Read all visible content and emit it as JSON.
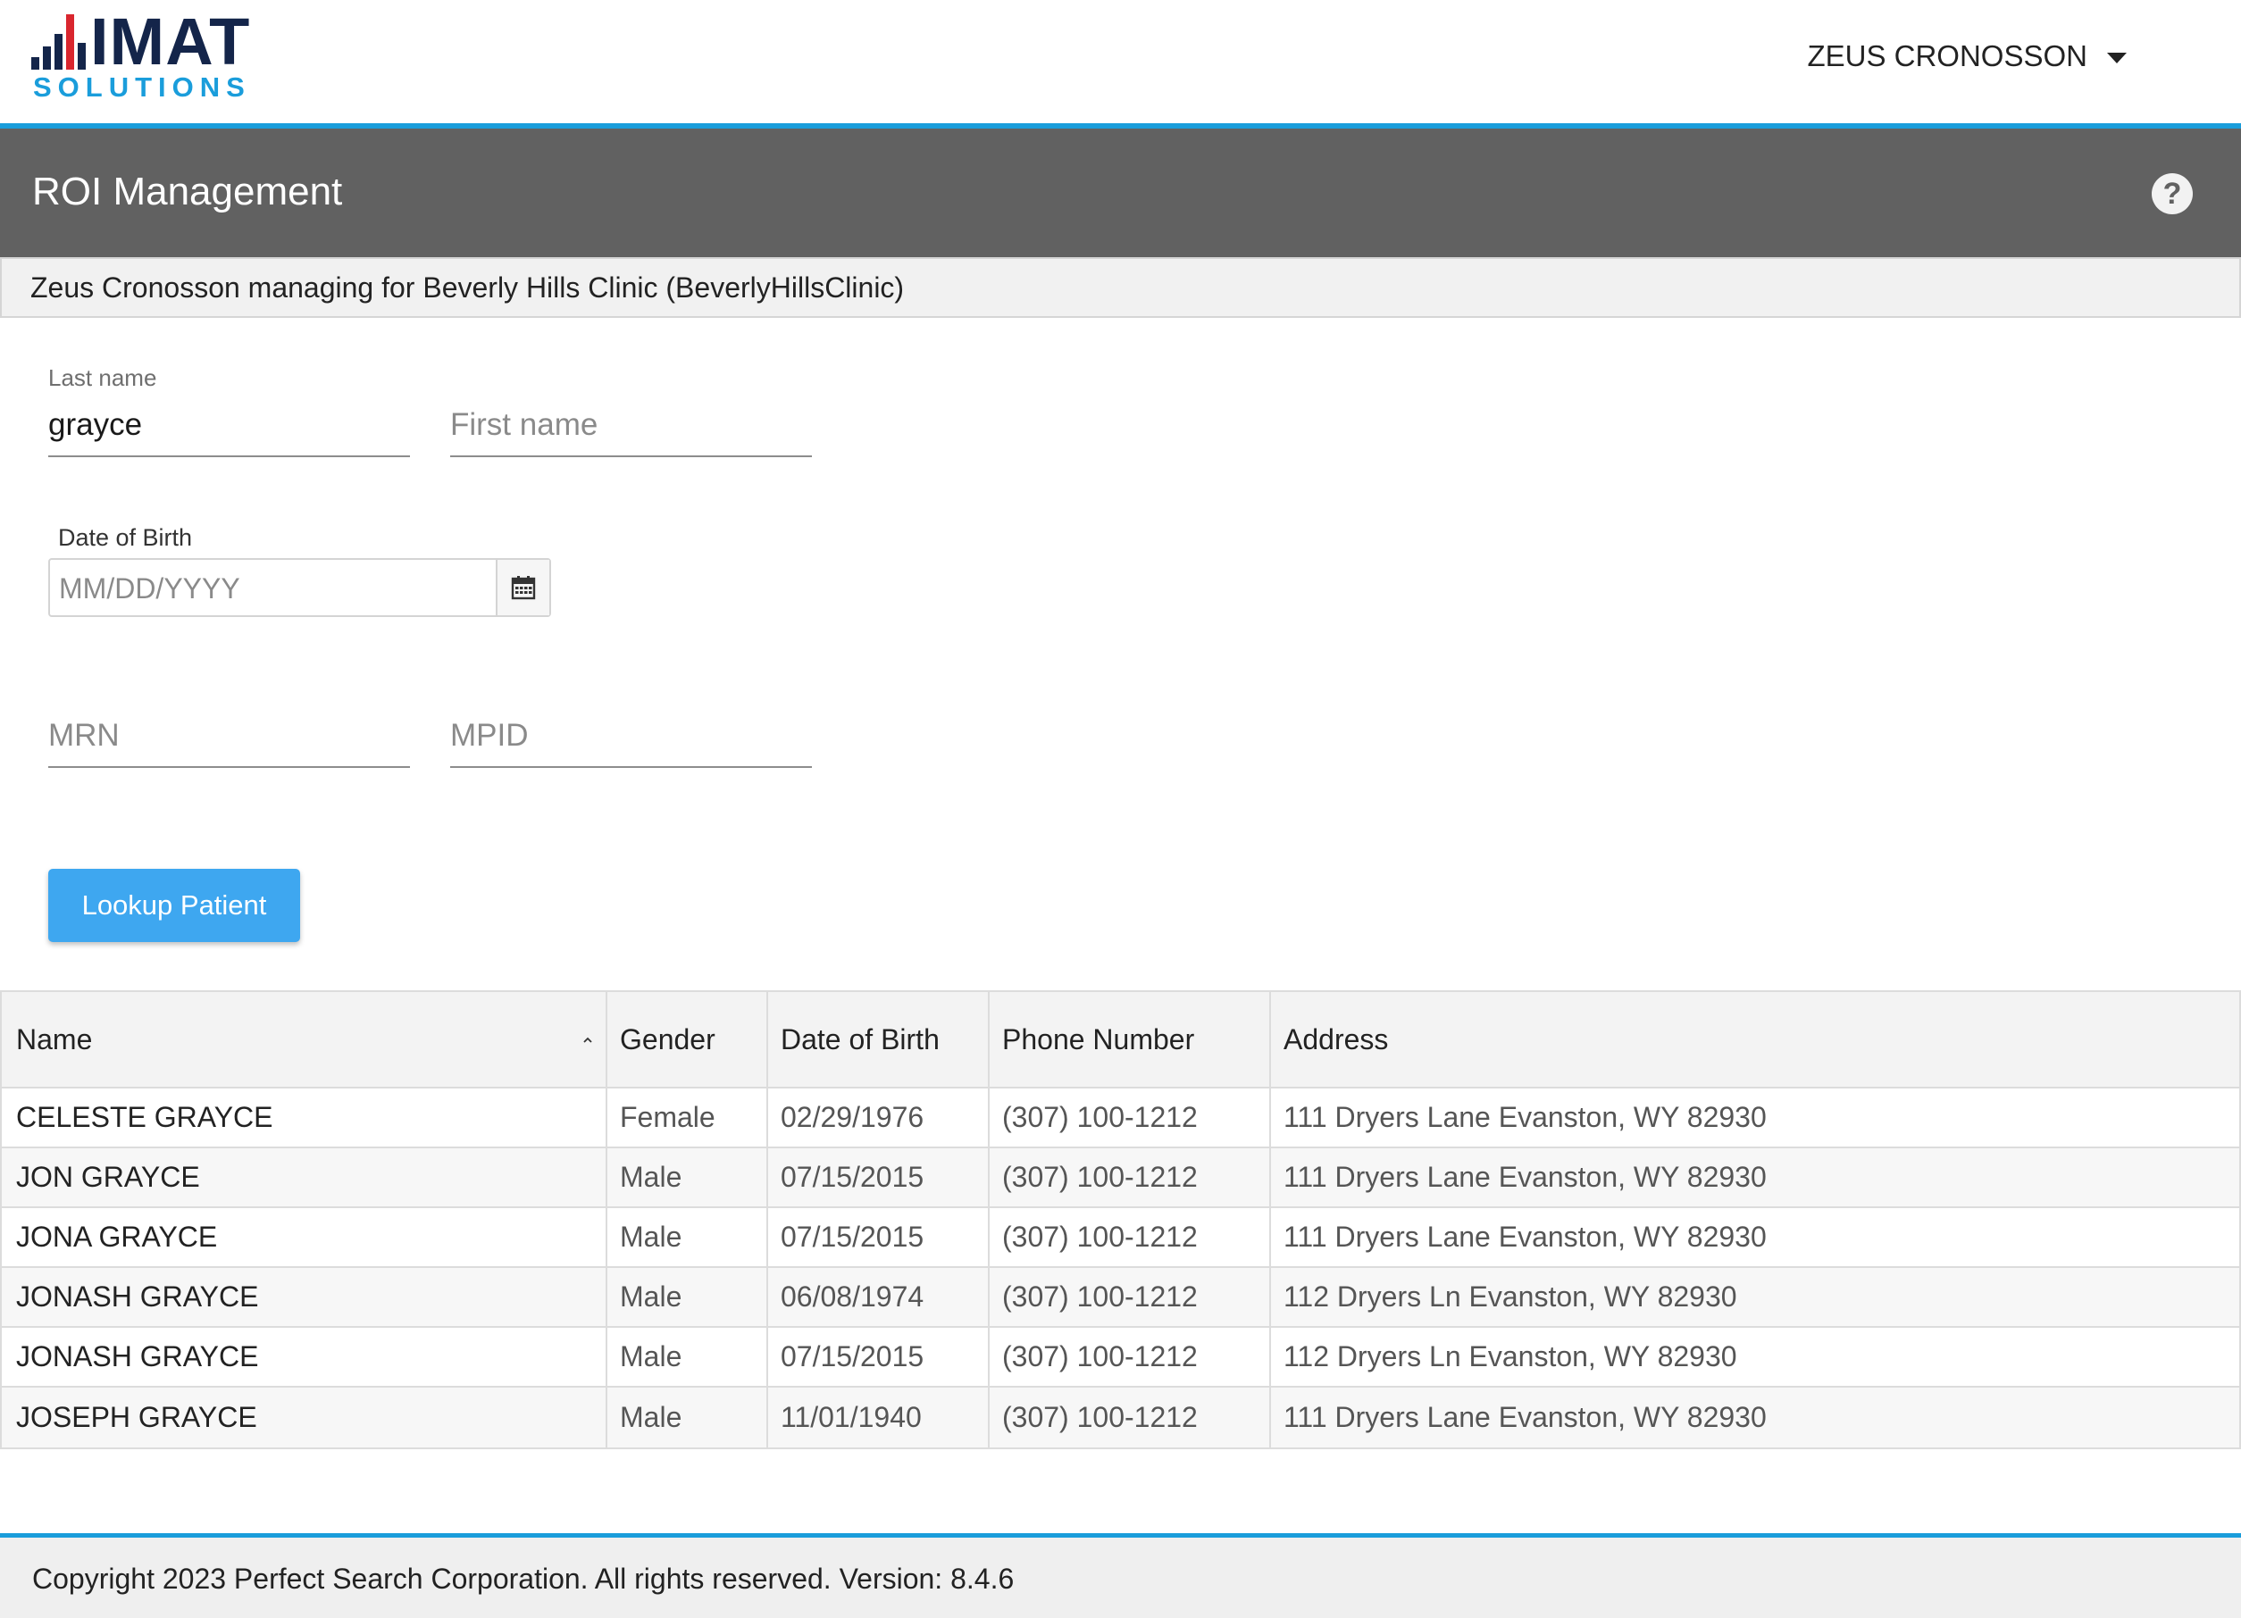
{
  "header": {
    "logo_top": "IMAT",
    "logo_bottom": "SOLUTIONS",
    "user_name": "ZEUS CRONOSSON"
  },
  "titlebar": {
    "title": "ROI Management",
    "help_label": "?"
  },
  "context": {
    "text": "Zeus Cronosson managing for Beverly Hills Clinic (BeverlyHillsClinic)"
  },
  "form": {
    "last_name_label": "Last name",
    "last_name_value": "grayce",
    "first_name_placeholder": "First name",
    "dob_label": "Date of Birth",
    "dob_placeholder": "MM/DD/YYYY",
    "mrn_placeholder": "MRN",
    "mpid_placeholder": "MPID",
    "lookup_label": "Lookup Patient"
  },
  "table": {
    "columns": [
      "Name",
      "Gender",
      "Date of Birth",
      "Phone Number",
      "Address"
    ],
    "rows": [
      [
        "CELESTE GRAYCE",
        "Female",
        "02/29/1976",
        "(307) 100-1212",
        "111 Dryers Lane Evanston, WY 82930"
      ],
      [
        "JON GRAYCE",
        "Male",
        "07/15/2015",
        "(307) 100-1212",
        "111 Dryers Lane Evanston, WY 82930"
      ],
      [
        "JONA GRAYCE",
        "Male",
        "07/15/2015",
        "(307) 100-1212",
        "111 Dryers Lane Evanston, WY 82930"
      ],
      [
        "JONASH GRAYCE",
        "Male",
        "06/08/1974",
        "(307) 100-1212",
        "112 Dryers Ln Evanston, WY 82930"
      ],
      [
        "JONASH GRAYCE",
        "Male",
        "07/15/2015",
        "(307) 100-1212",
        "112 Dryers Ln Evanston, WY 82930"
      ],
      [
        "JOSEPH GRAYCE",
        "Male",
        "11/01/1940",
        "(307) 100-1212",
        "111 Dryers Lane Evanston, WY 82930"
      ]
    ]
  },
  "footer": {
    "text": "Copyright 2023 Perfect Search Corporation. All rights reserved. Version: 8.4.6"
  },
  "colors": {
    "accent": "#1a9ddb",
    "titlebar": "#616161",
    "button": "#3ea7f0",
    "logo_navy": "#14254a",
    "logo_red": "#d9262e"
  },
  "icons": {
    "user_menu": "chevron-down-icon",
    "help": "help-icon",
    "date_picker": "calendar-icon",
    "sort": "sort-ascending-icon"
  }
}
